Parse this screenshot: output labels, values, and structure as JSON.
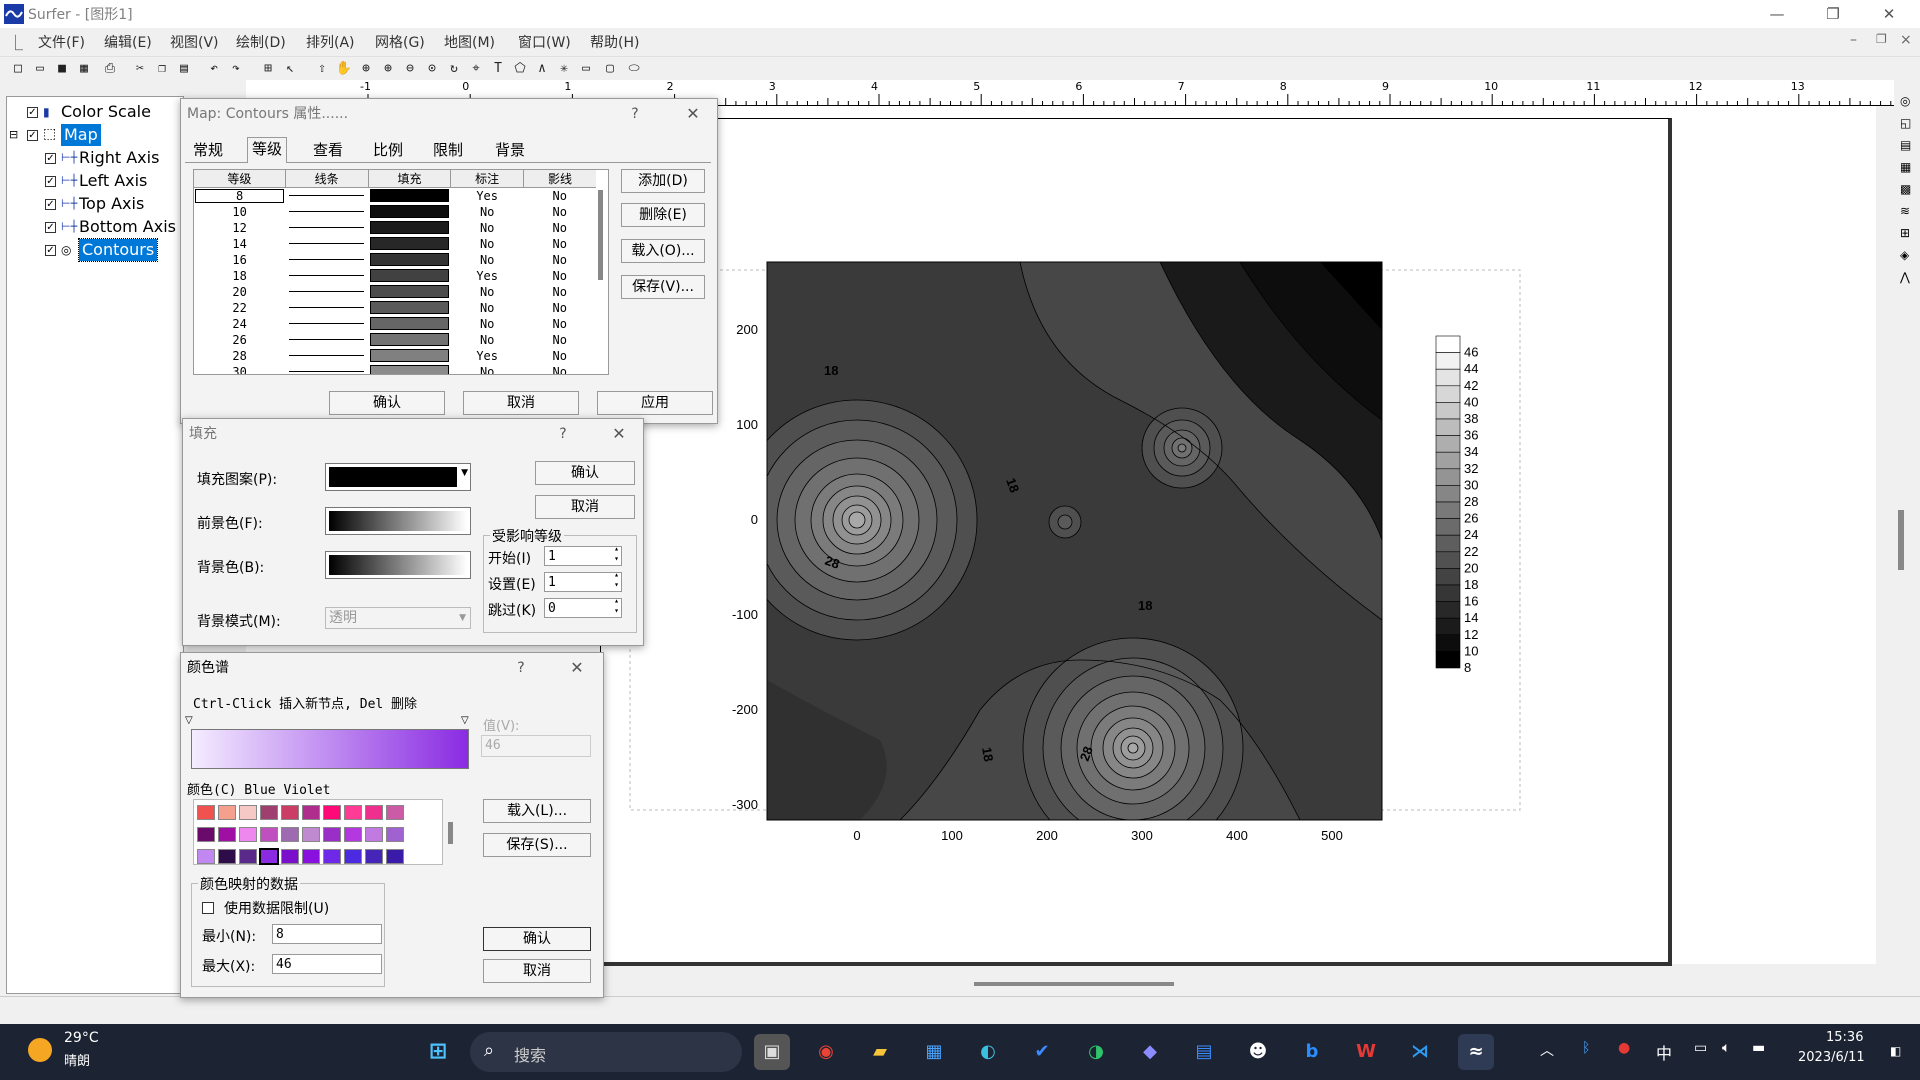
{
  "app": {
    "title": "Surfer - [图形1]"
  },
  "menu": [
    "文件(F)",
    "编辑(E)",
    "视图(V)",
    "绘制(D)",
    "排列(A)",
    "网格(G)",
    "地图(M)",
    "窗口(W)",
    "帮助(H)"
  ],
  "tree": {
    "items": [
      {
        "label": "Color Scale",
        "indent": 0,
        "selected": false
      },
      {
        "label": "Map",
        "indent": 0,
        "selected": true
      },
      {
        "label": "Right Axis",
        "indent": 1,
        "selected": false
      },
      {
        "label": "Left Axis",
        "indent": 1,
        "selected": false
      },
      {
        "label": "Top Axis",
        "indent": 1,
        "selected": false
      },
      {
        "label": "Bottom Axis",
        "indent": 1,
        "selected": false
      },
      {
        "label": "Contours",
        "indent": 1,
        "selected": true
      }
    ]
  },
  "ruler": {
    "ticks": [
      "-1",
      "0",
      "1",
      "2",
      "3",
      "4",
      "5",
      "6",
      "7",
      "8",
      "9",
      "10",
      "11",
      "12",
      "13"
    ]
  },
  "map": {
    "y_ticks": [
      "200",
      "100",
      "0",
      "-100",
      "-200",
      "-300"
    ],
    "x_ticks": [
      "0",
      "100",
      "200",
      "300",
      "400",
      "500"
    ],
    "contour_labels": [
      "18",
      "18",
      "28",
      "18",
      "18",
      "28"
    ],
    "colorscale": [
      "46",
      "44",
      "42",
      "40",
      "38",
      "36",
      "34",
      "32",
      "30",
      "28",
      "26",
      "24",
      "22",
      "20",
      "18",
      "16",
      "14",
      "12",
      "10",
      "8"
    ]
  },
  "contours_dialog": {
    "title": "Map: Contours 属性......",
    "tabs": [
      "常规",
      "等级",
      "查看",
      "比例",
      "限制",
      "背景"
    ],
    "active_tab": "等级",
    "columns": [
      "等级",
      "线条",
      "填充",
      "标注",
      "影线"
    ],
    "rows": [
      {
        "level": "8",
        "label": "Yes",
        "hatch": "No",
        "fill": "#000000"
      },
      {
        "level": "10",
        "label": "No",
        "hatch": "No",
        "fill": "#0e0e0e"
      },
      {
        "level": "12",
        "label": "No",
        "hatch": "No",
        "fill": "#1b1b1b"
      },
      {
        "level": "14",
        "label": "No",
        "hatch": "No",
        "fill": "#272727"
      },
      {
        "level": "16",
        "label": "No",
        "hatch": "No",
        "fill": "#343434"
      },
      {
        "level": "18",
        "label": "Yes",
        "hatch": "No",
        "fill": "#414141"
      },
      {
        "level": "20",
        "label": "No",
        "hatch": "No",
        "fill": "#4d4d4d"
      },
      {
        "level": "22",
        "label": "No",
        "hatch": "No",
        "fill": "#5a5a5a"
      },
      {
        "level": "24",
        "label": "No",
        "hatch": "No",
        "fill": "#666666"
      },
      {
        "level": "26",
        "label": "No",
        "hatch": "No",
        "fill": "#737373"
      },
      {
        "level": "28",
        "label": "Yes",
        "hatch": "No",
        "fill": "#808080"
      },
      {
        "level": "30",
        "label": "No",
        "hatch": "No",
        "fill": "#8c8c8c"
      }
    ],
    "buttons": {
      "add": "添加(D)",
      "delete": "删除(E)",
      "load": "载入(O)...",
      "save": "保存(V)..."
    },
    "footer": {
      "ok": "确认",
      "cancel": "取消",
      "apply": "应用"
    }
  },
  "fill_dialog": {
    "title": "填充",
    "pattern_label": "填充图案(P):",
    "fg_label": "前景色(F):",
    "bg_label": "背景色(B):",
    "bgmode_label": "背景模式(M):",
    "bgmode_value": "透明",
    "ok": "确认",
    "cancel": "取消",
    "group_title": "受影响等级",
    "start_label": "开始(I)",
    "start_value": "1",
    "set_label": "设置(E)",
    "set_value": "1",
    "skip_label": "跳过(K)",
    "skip_value": "0"
  },
  "spectrum_dialog": {
    "title": "颜色谱",
    "hint": "Ctrl-Click 插入新节点, Del 删除",
    "value_label": "值(V):",
    "value": "46",
    "color_label": "颜色(C) Blue Violet",
    "load": "载入(L)...",
    "save": "保存(S)...",
    "group_title": "颜色映射的数据",
    "use_limits": "使用数据限制(U)",
    "min_label": "最小(N):",
    "min_value": "8",
    "max_label": "最大(X):",
    "max_value": "46",
    "ok": "确认",
    "cancel": "取消",
    "palette": [
      "#f0524f",
      "#f5a08e",
      "#f6c9c6",
      "#9e3f70",
      "#cc3d66",
      "#b02d8e",
      "#ff0877",
      "#ff3b96",
      "#ef2f8e",
      "#cb5ba4",
      "#6a0a6a",
      "#a00fa4",
      "#ee88ee",
      "#c050c0",
      "#9e6ab0",
      "#c08ad0",
      "#9a2fc8",
      "#b338e0",
      "#c07ae0",
      "#a062d0",
      "#c088f0",
      "#2e0c4a",
      "#5a2a8a",
      "#8a2be2",
      "#7a10cc",
      "#8a10e0",
      "#7028e8",
      "#4b2ae0",
      "#4525b8",
      "#3a1aa8"
    ]
  },
  "taskbar": {
    "weather_temp": "29°C",
    "weather_desc": "晴朗",
    "search": "搜索",
    "ime": "中",
    "time": "15:36",
    "date": "2023/6/11"
  }
}
